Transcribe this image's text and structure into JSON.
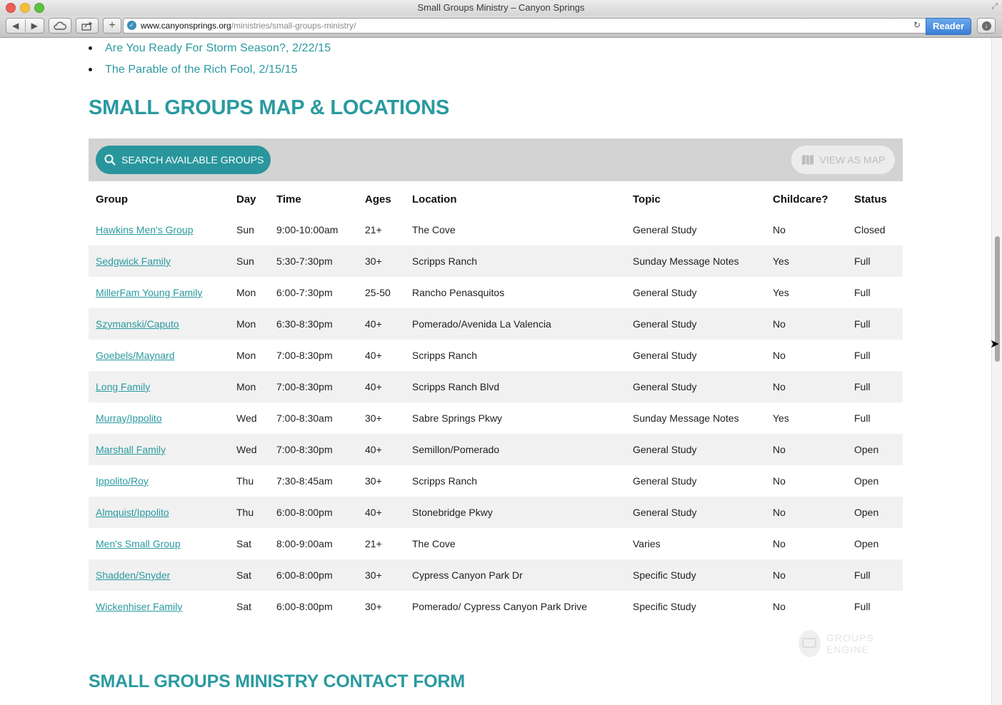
{
  "window": {
    "title": "Small Groups Ministry – Canyon Springs"
  },
  "toolbar": {
    "url_domain": "www.canyonsprings.org",
    "url_path": "/ministries/small-groups-ministry/",
    "reader_label": "Reader"
  },
  "sermons": [
    "Are You Ready For Storm Season?, 2/22/15",
    "The Parable of the Rich Fool, 2/15/15"
  ],
  "map_section": {
    "title": "SMALL GROUPS MAP & LOCATIONS",
    "search_label": "SEARCH AVAILABLE GROUPS",
    "map_label": "VIEW AS MAP"
  },
  "table": {
    "headers": [
      "Group",
      "Day",
      "Time",
      "Ages",
      "Location",
      "Topic",
      "Childcare?",
      "Status"
    ],
    "rows": [
      [
        "Hawkins Men's Group",
        "Sun",
        "9:00-10:00am",
        "21+",
        "The Cove",
        "General Study",
        "No",
        "Closed"
      ],
      [
        "Sedgwick Family",
        "Sun",
        "5:30-7:30pm",
        "30+",
        "Scripps Ranch",
        "Sunday Message Notes",
        "Yes",
        "Full"
      ],
      [
        "MillerFam Young Family",
        "Mon",
        "6:00-7:30pm",
        "25-50",
        "Rancho Penasquitos",
        "General Study",
        "Yes",
        "Full"
      ],
      [
        "Szymanski/Caputo",
        "Mon",
        "6:30-8:30pm",
        "40+",
        "Pomerado/Avenida La Valencia",
        "General Study",
        "No",
        "Full"
      ],
      [
        "Goebels/Maynard",
        "Mon",
        "7:00-8:30pm",
        "40+",
        "Scripps Ranch",
        "General Study",
        "No",
        "Full"
      ],
      [
        "Long Family",
        "Mon",
        "7:00-8:30pm",
        "40+",
        "Scripps Ranch Blvd",
        "General Study",
        "No",
        "Full"
      ],
      [
        "Murray/Ippolito",
        "Wed",
        "7:00-8:30am",
        "30+",
        "Sabre Springs Pkwy",
        "Sunday Message Notes",
        "Yes",
        "Full"
      ],
      [
        "Marshall Family",
        "Wed",
        "7:00-8:30pm",
        "40+",
        "Semillon/Pomerado",
        "General Study",
        "No",
        "Open"
      ],
      [
        "Ippolito/Roy",
        "Thu",
        "7:30-8:45am",
        "30+",
        "Scripps Ranch",
        "General Study",
        "No",
        "Open"
      ],
      [
        "Almquist/Ippolito",
        "Thu",
        "6:00-8:00pm",
        "40+",
        "Stonebridge Pkwy",
        "General Study",
        "No",
        "Open"
      ],
      [
        "Men's Small Group",
        "Sat",
        "8:00-9:00am",
        "21+",
        "The Cove",
        "Varies",
        "No",
        "Open"
      ],
      [
        "Shadden/Snyder",
        "Sat",
        "6:00-8:00pm",
        "30+",
        "Cypress Canyon Park Dr",
        "Specific Study",
        "No",
        "Full"
      ],
      [
        "Wickenhiser Family",
        "Sat",
        "6:00-8:00pm",
        "30+",
        "Pomerado/ Cypress Canyon Park Drive",
        "Specific Study",
        "No",
        "Full"
      ]
    ]
  },
  "branding": {
    "groups_engine": "GROUPS ENGINE"
  },
  "contact_section": {
    "title": "SMALL GROUPS MINISTRY CONTACT FORM"
  },
  "scroll": {
    "position_fraction": 0.34
  },
  "colors": {
    "accent": "#2a9aa0",
    "button": "#28969c",
    "bar": "#d3d3d3"
  }
}
